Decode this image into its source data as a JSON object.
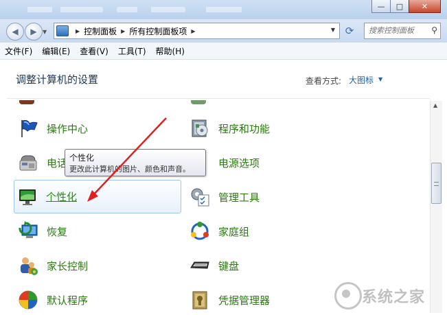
{
  "window": {
    "controls": {
      "minimize": "—",
      "maximize": "□",
      "close": "✕"
    }
  },
  "address": {
    "crumbs": [
      "控制面板",
      "所有控制面板项"
    ],
    "search_placeholder": "搜索控制面板"
  },
  "menu": [
    "文件(F)",
    "编辑(E)",
    "查看(V)",
    "工具(T)",
    "帮助(H)"
  ],
  "header": {
    "title": "调整计算机的设置",
    "view_label": "查看方式:",
    "view_value": "大图标"
  },
  "items_left": [
    {
      "label": "操作中心",
      "icon": "action-center-flag-icon"
    },
    {
      "label": "电话和调制解调器",
      "icon": "phone-modem-icon"
    },
    {
      "label": "个性化",
      "icon": "personalization-monitor-icon"
    },
    {
      "label": "恢复",
      "icon": "recovery-icon"
    },
    {
      "label": "家长控制",
      "icon": "parental-control-icon"
    },
    {
      "label": "默认程序",
      "icon": "default-programs-icon"
    }
  ],
  "items_right": [
    {
      "label": "程序和功能",
      "icon": "programs-features-icon"
    },
    {
      "label": "电源选项",
      "icon": "power-options-icon"
    },
    {
      "label": "管理工具",
      "icon": "admin-tools-icon"
    },
    {
      "label": "家庭组",
      "icon": "homegroup-icon"
    },
    {
      "label": "键盘",
      "icon": "keyboard-icon"
    },
    {
      "label": "凭据管理器",
      "icon": "credential-manager-icon"
    }
  ],
  "tooltip": {
    "title": "个性化",
    "description": "更改此计算机的图片、颜色和声音。"
  },
  "watermark": {
    "text": "系统之家"
  },
  "colors": {
    "link_green": "#2a7a10",
    "title_blue": "#1e395b",
    "annotation_red": "#e02020"
  }
}
